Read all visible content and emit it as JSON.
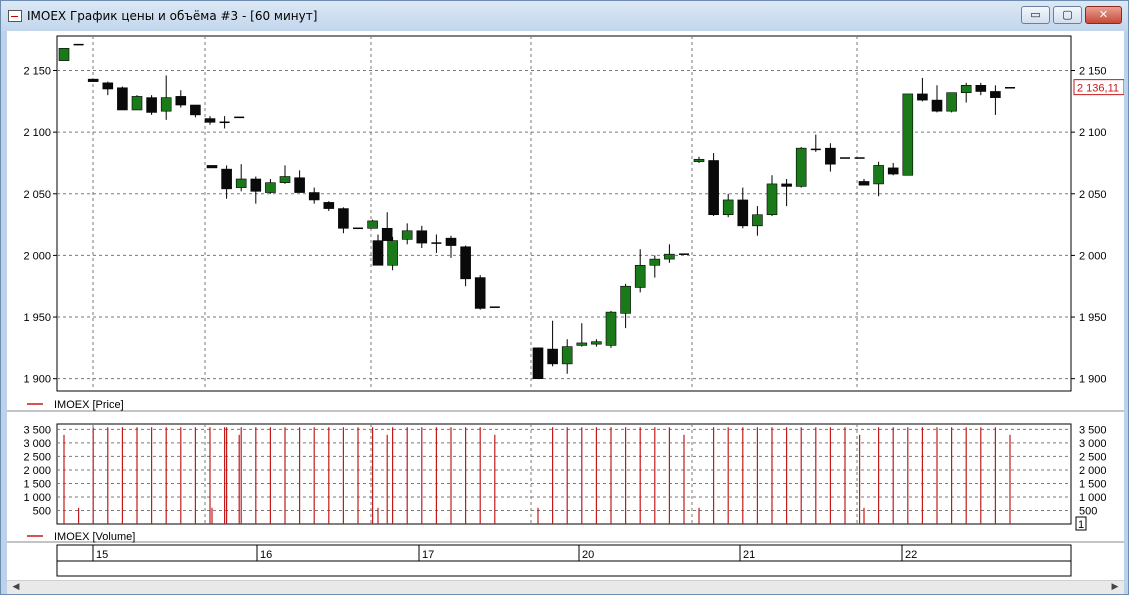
{
  "window": {
    "title": "IMOEX График цены и объёма #3 - [60 минут]",
    "buttons": {
      "minimize": "▭",
      "maximize": "▢",
      "close": "✕"
    },
    "icon": "chart-window-icon"
  },
  "colors": {
    "up": "#1a7a1a",
    "down": "#0a0a0a",
    "volume": "#c21a1a",
    "grid": "#7a7a7a",
    "price_tag": "#c21a1a"
  },
  "chart_data": [
    {
      "type": "candlestick",
      "legend": "IMOEX [Price]",
      "ylim": [
        1890,
        2178
      ],
      "yticks": [
        {
          "value": 1900,
          "label": "1 900"
        },
        {
          "value": 1950,
          "label": "1 950"
        },
        {
          "value": 2000,
          "label": "2 000"
        },
        {
          "value": 2050,
          "label": "2 050"
        },
        {
          "value": 2100,
          "label": "2 100"
        },
        {
          "value": 2150,
          "label": "2 150"
        }
      ],
      "last_price": 2136.11,
      "last_price_label": "2 136,11",
      "days": [
        {
          "label": "15",
          "candles": [
            [
              2158,
              2168,
              2158,
              2168
            ],
            [
              2171,
              2171,
              2171,
              2171
            ],
            [
              2143,
              2143,
              2141,
              2141
            ],
            [
              2140,
              2141,
              2130,
              2135
            ],
            [
              2136,
              2137,
              2118,
              2118
            ],
            [
              2118,
              2130,
              2118,
              2129
            ],
            [
              2128,
              2130,
              2114,
              2116
            ],
            [
              2117,
              2146,
              2110,
              2128
            ],
            [
              2129,
              2134,
              2120,
              2122
            ],
            [
              2122,
              2122,
              2112,
              2114
            ],
            [
              2111,
              2113,
              2106,
              2108
            ],
            [
              2108,
              2113,
              2103,
              2108
            ],
            [
              2112,
              2112,
              2112,
              2112
            ]
          ]
        },
        {
          "label": "16",
          "candles": [
            [
              2073,
              2073,
              2071,
              2071
            ],
            [
              2070,
              2073,
              2046,
              2054
            ],
            [
              2055,
              2074,
              2052,
              2062
            ],
            [
              2062,
              2064,
              2042,
              2052
            ],
            [
              2051,
              2062,
              2050,
              2059
            ],
            [
              2059,
              2073,
              2058,
              2064
            ],
            [
              2063,
              2069,
              2051,
              2051
            ],
            [
              2051,
              2055,
              2042,
              2045
            ],
            [
              2043,
              2044,
              2036,
              2038
            ],
            [
              2038,
              2039,
              2018,
              2022
            ],
            [
              2022,
              2022,
              2022,
              2022
            ],
            [
              2022,
              2029,
              2022,
              2028
            ],
            [
              2022,
              2035,
              2012,
              2012
            ]
          ]
        },
        {
          "label": "17",
          "candles": [
            [
              2012,
              2017,
              1993,
              1992
            ],
            [
              1992,
              2015,
              1988,
              2012
            ],
            [
              2013,
              2026,
              2009,
              2020
            ],
            [
              2020,
              2024,
              2006,
              2010
            ],
            [
              2010,
              2017,
              2002,
              2009
            ],
            [
              2014,
              2016,
              1998,
              2008
            ],
            [
              2007,
              2008,
              1975,
              1981
            ],
            [
              1982,
              1984,
              1956,
              1957
            ],
            [
              1958,
              1958,
              1958,
              1958
            ]
          ]
        },
        {
          "label": "20",
          "candles": [
            [
              1925,
              1925,
              1900,
              1900
            ],
            [
              1924,
              1947,
              1910,
              1912
            ],
            [
              1912,
              1932,
              1904,
              1926
            ],
            [
              1927,
              1945,
              1926,
              1929
            ],
            [
              1928,
              1932,
              1926,
              1930
            ],
            [
              1927,
              1955,
              1925,
              1954
            ],
            [
              1953,
              1977,
              1941,
              1975
            ],
            [
              1974,
              2005,
              1970,
              1992
            ],
            [
              1992,
              2000,
              1982,
              1997
            ],
            [
              1997,
              2009,
              1994,
              2001
            ],
            [
              2001,
              2001,
              2001,
              2001
            ]
          ]
        },
        {
          "label": "21",
          "candles": [
            [
              2076,
              2080,
              2075,
              2078
            ],
            [
              2077,
              2083,
              2032,
              2033
            ],
            [
              2033,
              2050,
              2031,
              2045
            ],
            [
              2045,
              2055,
              2022,
              2024
            ],
            [
              2024,
              2040,
              2016,
              2033
            ],
            [
              2033,
              2065,
              2032,
              2058
            ],
            [
              2058,
              2062,
              2040,
              2056
            ],
            [
              2056,
              2088,
              2055,
              2087
            ],
            [
              2085,
              2098,
              2084,
              2086
            ],
            [
              2087,
              2091,
              2068,
              2074
            ],
            [
              2079,
              2079,
              2079,
              2079
            ],
            [
              2079,
              2079,
              2079,
              2079
            ]
          ]
        },
        {
          "label": "22",
          "candles": [
            [
              2060,
              2062,
              2057,
              2057
            ],
            [
              2058,
              2076,
              2048,
              2073
            ],
            [
              2071,
              2075,
              2065,
              2066
            ],
            [
              2065,
              2131,
              2065,
              2131
            ],
            [
              2131,
              2144,
              2125,
              2126
            ],
            [
              2126,
              2138,
              2116,
              2117
            ],
            [
              2117,
              2132,
              2116,
              2132
            ],
            [
              2132,
              2140,
              2124,
              2138
            ],
            [
              2138,
              2140,
              2130,
              2133
            ],
            [
              2133,
              2138,
              2114,
              2128
            ],
            [
              2136,
              2136,
              2136,
              2136
            ]
          ]
        }
      ]
    },
    {
      "type": "bar",
      "legend": "IMOEX [Volume]",
      "ylim": [
        0,
        3700
      ],
      "yticks": [
        {
          "value": 500,
          "label": "500"
        },
        {
          "value": 1000,
          "label": "1 000"
        },
        {
          "value": 1500,
          "label": "1 500"
        },
        {
          "value": 2000,
          "label": "2 000"
        },
        {
          "value": 2500,
          "label": "2 500"
        },
        {
          "value": 3000,
          "label": "3 000"
        },
        {
          "value": 3500,
          "label": "3 500"
        }
      ],
      "marker_label": "1",
      "days": [
        {
          "label": "15",
          "values": [
            3300,
            600,
            3580,
            3580,
            3580,
            3580,
            3580,
            3580,
            3580,
            3580,
            3580,
            3580,
            3300
          ]
        },
        {
          "label": "16",
          "values": [
            600,
            3580,
            3580,
            3580,
            3580,
            3580,
            3580,
            3580,
            3580,
            3580,
            3580,
            3580,
            3300
          ]
        },
        {
          "label": "17",
          "values": [
            600,
            3580,
            3580,
            3580,
            3580,
            3580,
            3580,
            3580,
            3300
          ]
        },
        {
          "label": "20",
          "values": [
            600,
            3580,
            3580,
            3580,
            3580,
            3580,
            3580,
            3580,
            3580,
            3580,
            3300
          ]
        },
        {
          "label": "21",
          "values": [
            600,
            3580,
            3580,
            3580,
            3580,
            3580,
            3580,
            3580,
            3580,
            3580,
            3580,
            3300
          ]
        },
        {
          "label": "22",
          "values": [
            600,
            3580,
            3580,
            3580,
            3580,
            3580,
            3580,
            3580,
            3580,
            3580,
            3300
          ]
        }
      ]
    }
  ]
}
